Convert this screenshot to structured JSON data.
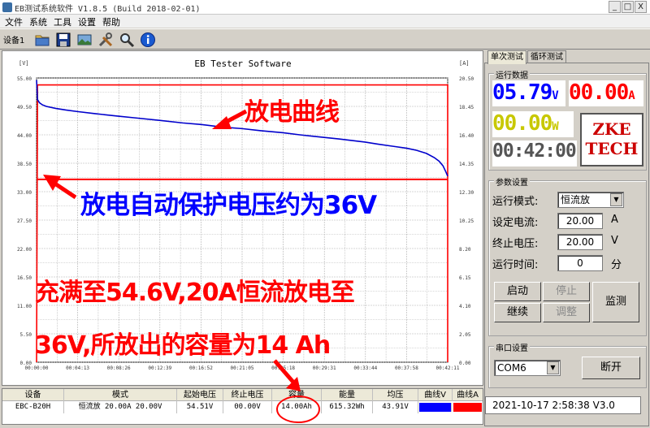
{
  "window": {
    "title": "EB测试系统软件 V1.8.5 (Build 2018-02-01)",
    "minimize": "_",
    "maximize": "□",
    "close": "X"
  },
  "menu": [
    "文件",
    "系统",
    "工具",
    "设置",
    "帮助"
  ],
  "toolbar": {
    "device_tab": "设备1",
    "icons": [
      "open-folder-icon",
      "save-icon",
      "image-icon",
      "tools-icon",
      "search-icon",
      "info-icon"
    ]
  },
  "chart_data": {
    "type": "line",
    "title": "EB Tester Software",
    "left_unit": "[V]",
    "right_unit": "[A]",
    "yleft_ticks": [
      "55.00",
      "49.50",
      "44.00",
      "38.50",
      "33.00",
      "27.50",
      "22.00",
      "16.50",
      "11.00",
      "5.50",
      "0.00"
    ],
    "yright_ticks": [
      "20.50",
      "18.45",
      "16.40",
      "14.35",
      "12.30",
      "10.25",
      "8.20",
      "6.15",
      "4.10",
      "2.05",
      "0.00"
    ],
    "x_ticks": [
      "00:00:00",
      "00:04:13",
      "00:08:26",
      "00:12:39",
      "00:16:52",
      "00:21:05",
      "00:25:18",
      "00:29:31",
      "00:33:44",
      "00:37:58",
      "00:42:11"
    ],
    "ylim_left": [
      0,
      55
    ],
    "ylim_right": [
      0,
      20.5
    ],
    "xlim_minutes": [
      0,
      42.18
    ],
    "grid": true,
    "series": [
      {
        "color": "#0000cc",
        "axis": "left",
        "x_minutes": [
          0,
          0.1,
          0.3,
          0.6,
          1.0,
          2.0,
          3.0,
          4.2,
          6,
          8.4,
          10,
          12.6,
          15,
          16.9,
          19,
          21.1,
          23,
          25.3,
          27,
          29.5,
          31,
          33.7,
          35,
          36.5,
          38.0,
          39.0,
          40.0,
          40.8,
          41.3,
          41.7,
          42.0,
          42.18
        ],
        "voltage": [
          54.6,
          50.8,
          50.2,
          49.8,
          49.5,
          49.1,
          48.8,
          48.5,
          48.1,
          47.6,
          47.3,
          46.8,
          46.3,
          46.0,
          45.5,
          45.2,
          44.8,
          44.4,
          44.0,
          43.5,
          43.2,
          42.6,
          42.2,
          41.8,
          41.4,
          41.0,
          40.4,
          39.6,
          38.9,
          38.0,
          36.8,
          36.0
        ]
      },
      {
        "color": "#ff0000",
        "axis": "right",
        "x_minutes": [
          0,
          0.1,
          42.18,
          42.18
        ],
        "current": [
          0,
          20.0,
          20.0,
          0
        ]
      }
    ]
  },
  "annotations": {
    "curve": "放电曲线",
    "protect": "放电自动保护电压约为36V",
    "charge_line1": "充满至54.6V,20A恒流放电至",
    "charge_line2": "36V,所放出的容量为14 Ah"
  },
  "table": {
    "headers": [
      "设备",
      "模式",
      "起始电压",
      "终止电压",
      "容量",
      "能量",
      "均压",
      "曲线V",
      "曲线A"
    ],
    "row": [
      "EBC-B20H",
      "恒流放  20.00A  20.00V",
      "54.51V",
      "00.00V",
      "14.00Ah",
      "615.32Wh",
      "43.91V",
      "",
      ""
    ],
    "curve_v_color": "#0000ff",
    "curve_a_color": "#ff0000"
  },
  "right_panel": {
    "tabs": [
      "单次测试",
      "循环测试"
    ],
    "run_data_title": "运行数据",
    "voltage": "05.79",
    "voltage_unit": "V",
    "current": "00.00",
    "current_unit": "A",
    "power": "00.00",
    "power_unit": "W",
    "time": "00:42:00",
    "logo_l1": "ZKE",
    "logo_l2": "TECH",
    "params_title": "参数设置",
    "mode_label": "运行模式:",
    "mode_value": "恒流放",
    "set_current_label": "设定电流:",
    "set_current_value": "20.00",
    "set_current_unit": "A",
    "end_voltage_label": "终止电压:",
    "end_voltage_value": "20.00",
    "end_voltage_unit": "V",
    "run_time_label": "运行时间:",
    "run_time_value": "0",
    "run_time_unit": "分",
    "btn_start": "启动",
    "btn_stop": "停止",
    "btn_continue": "继续",
    "btn_adjust": "调整",
    "btn_monitor": "监测",
    "serial_title": "串口设置",
    "port_value": "COM6",
    "btn_disconnect": "断开",
    "status": "2021-10-17 2:58:38  V3.0"
  },
  "colors": {
    "voltage_lcd": "#0000ff",
    "current_lcd": "#ff0000",
    "power_lcd": "#c8c800",
    "time_lcd": "#555555"
  }
}
